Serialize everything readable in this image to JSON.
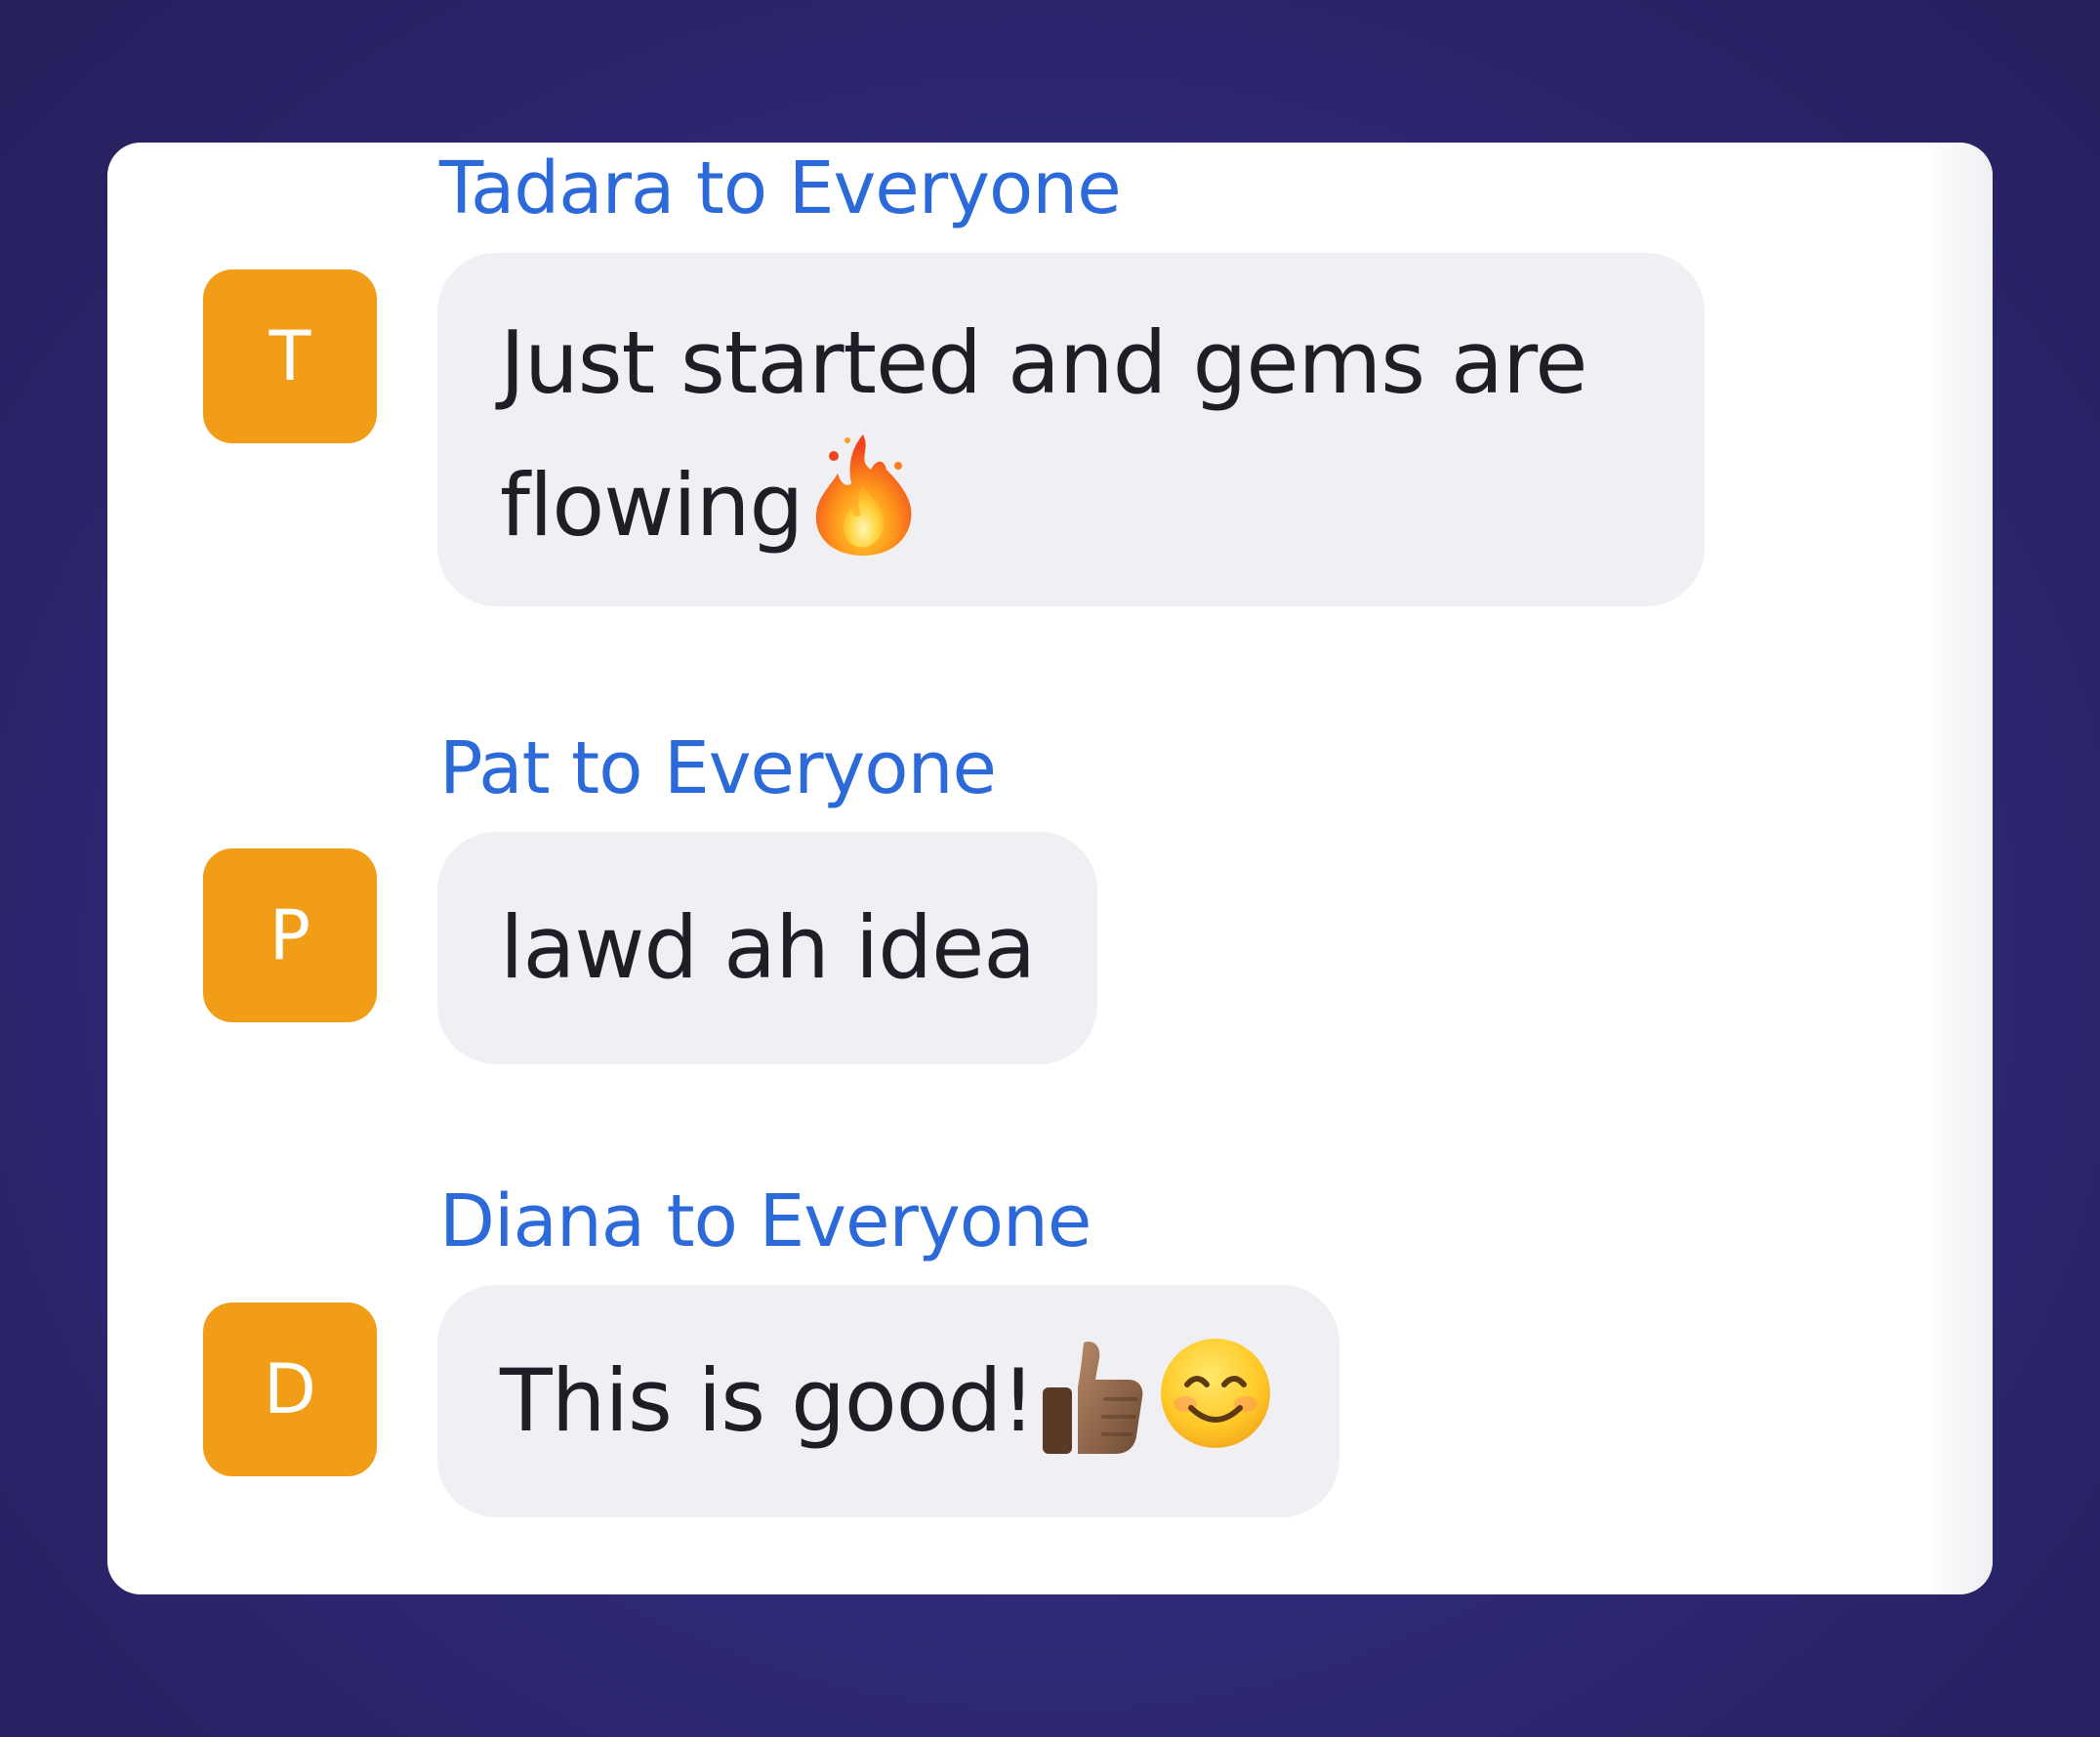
{
  "chat": {
    "messages": [
      {
        "sender": "Tadara to Everyone",
        "initial": "T",
        "text_line1": "Just started and gems are",
        "text_line2": "flowing",
        "emoji": "fire-emoji"
      },
      {
        "sender": "Pat to Everyone",
        "initial": "P",
        "text": "lawd ah idea"
      },
      {
        "sender": "Diana to Everyone",
        "initial": "D",
        "text": "This is good!",
        "emojis": [
          "thumbs-up-emoji",
          "smiling-face-emoji"
        ]
      }
    ]
  },
  "colors": {
    "background": "#302b7a",
    "card": "#ffffff",
    "bubble": "#f0f0f4",
    "sender_name": "#2d6ad9",
    "avatar": "#f29d17",
    "avatar_text": "#ffffff",
    "message_text": "#1e1e26"
  }
}
